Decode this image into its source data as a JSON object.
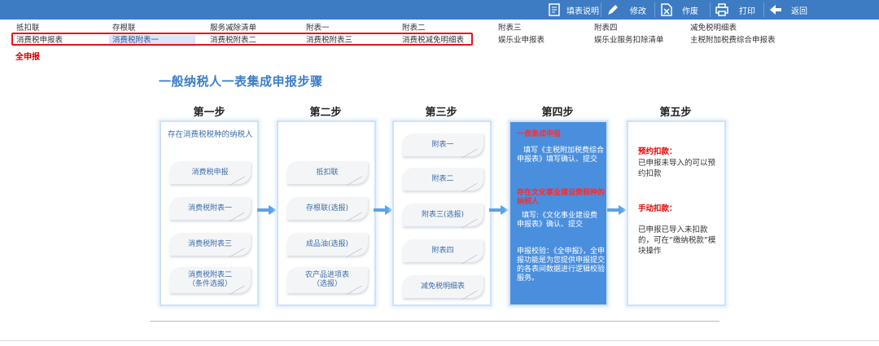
{
  "toolbar": {
    "fill_instructions": "填表说明",
    "modify": "修改",
    "void": "作废",
    "print": "打印",
    "back": "返回"
  },
  "nav_row1": [
    "抵扣联",
    "存根联",
    "服务减除清单",
    "附表一",
    "附表二",
    "附表三",
    "附表四",
    "减免税明细表"
  ],
  "nav_row2": [
    "消费税申报表",
    "消费税附表一",
    "消费税附表二",
    "消费税附表三",
    "消费税减免明细表",
    "娱乐业申报表",
    "娱乐业服务扣除清单",
    "主税附加税费综合申报表"
  ],
  "full_report": "全申报",
  "main": {
    "title": "一般纳税人一表集成申报步骤",
    "steps": [
      "第一步",
      "第二步",
      "第三步",
      "第四步",
      "第五步"
    ],
    "step1": {
      "intro": "存在消费税税种的纳税人",
      "items": [
        "消费税申报",
        "消费税附表一",
        "消费税附表三",
        "消费税附表二\n（条件选报）"
      ]
    },
    "step2": {
      "items": [
        "抵扣联",
        "存根联(选报)",
        "成品油(选报)",
        "农产品进项表\n（选报）"
      ]
    },
    "step3": {
      "items": [
        "附表一",
        "附表二",
        "附表三(选报)",
        "附表四",
        "减免税明细表"
      ]
    },
    "step4": {
      "h1": "一表集成申报",
      "p1": "填写《主税附加税费综合申报表》填写确认、提交",
      "h2": "存在文化事业建设费税种的纳税人",
      "p2": "填写:《文化事业建设费申报表》确认、提交",
      "p3": "申报校验：《全申报》，全申报功能是为您提供申报提交的各表间数据进行逻辑校验服务。"
    },
    "step5": {
      "h1": "预约扣款：",
      "p1": "已申报未导入的可以预约扣款",
      "h2": "手动扣款：",
      "p2": "已申报已导入未扣款的，可在“缴纳税款”模块操作"
    }
  },
  "colors": {
    "toolbar": "#3d7cc3",
    "accent": "#3b7fc8",
    "highlight_box": "#e6141e",
    "step4_bg": "#4a8fde"
  }
}
